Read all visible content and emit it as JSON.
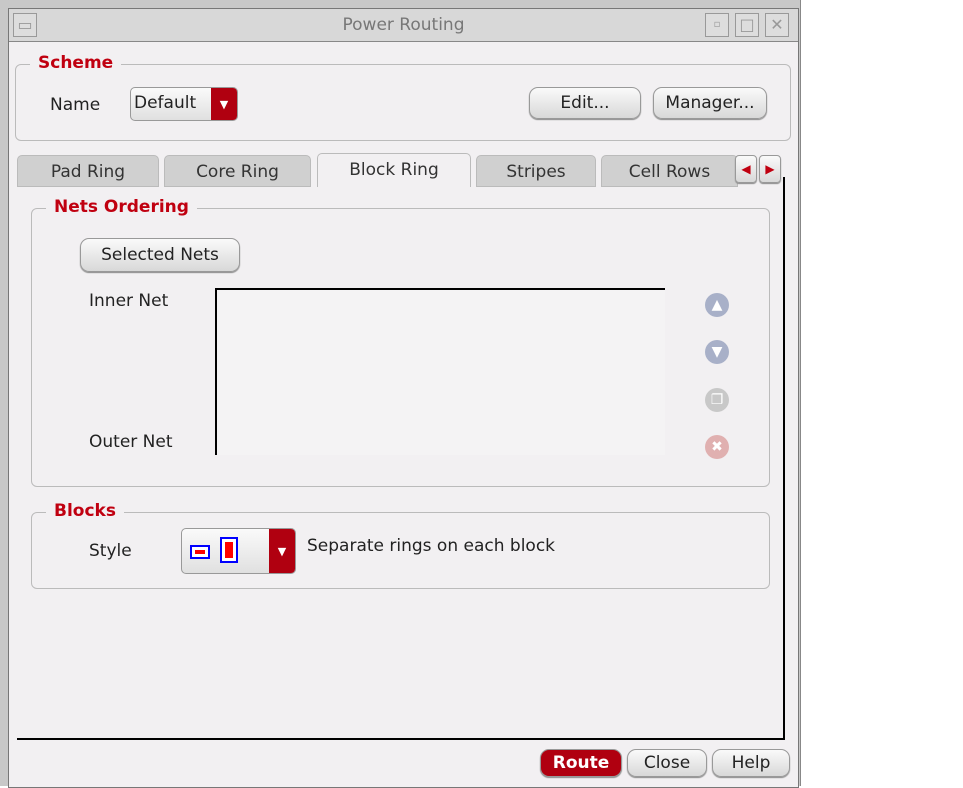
{
  "window": {
    "title": "Power Routing"
  },
  "scheme": {
    "legend": "Scheme",
    "name_label": "Name",
    "name_value": "Default",
    "edit": "Edit...",
    "manager": "Manager..."
  },
  "tabs": [
    "Pad Ring",
    "Core Ring",
    "Block Ring",
    "Stripes",
    "Cell Rows"
  ],
  "nets": {
    "legend": "Nets Ordering",
    "selected_nets": "Selected Nets",
    "inner": "Inner Net",
    "outer": "Outer Net"
  },
  "blocks": {
    "legend": "Blocks",
    "style_label": "Style",
    "style_desc": "Separate rings on each block"
  },
  "footer": {
    "route": "Route",
    "close": "Close",
    "help": "Help"
  },
  "colors": {
    "accent": "#c00010"
  }
}
